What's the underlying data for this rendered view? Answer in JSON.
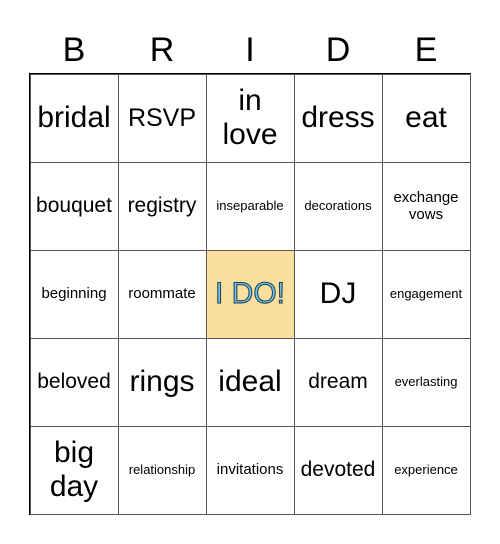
{
  "header": [
    "B",
    "R",
    "I",
    "D",
    "E"
  ],
  "cells": [
    {
      "text": "bridal",
      "size": "l"
    },
    {
      "text": "RSVP",
      "size": "m2"
    },
    {
      "text": "in love",
      "size": "l"
    },
    {
      "text": "dress",
      "size": "l"
    },
    {
      "text": "eat",
      "size": "l"
    },
    {
      "text": "bouquet",
      "size": "m"
    },
    {
      "text": "registry",
      "size": "m"
    },
    {
      "text": "inseparable",
      "size": "xs"
    },
    {
      "text": "decorations",
      "size": "xs"
    },
    {
      "text": "exchange vows",
      "size": "s"
    },
    {
      "text": "beginning",
      "size": "s"
    },
    {
      "text": "roommate",
      "size": "s"
    },
    {
      "text": "I DO!",
      "size": "free"
    },
    {
      "text": "DJ",
      "size": "l"
    },
    {
      "text": "engagement",
      "size": "xs"
    },
    {
      "text": "beloved",
      "size": "m"
    },
    {
      "text": "rings",
      "size": "l"
    },
    {
      "text": "ideal",
      "size": "l"
    },
    {
      "text": "dream",
      "size": "m"
    },
    {
      "text": "everlasting",
      "size": "xs"
    },
    {
      "text": "big day",
      "size": "l"
    },
    {
      "text": "relationship",
      "size": "xs"
    },
    {
      "text": "invitations",
      "size": "s"
    },
    {
      "text": "devoted",
      "size": "m"
    },
    {
      "text": "experience",
      "size": "xs"
    }
  ],
  "colors": {
    "free_bg": "#fbdf9f",
    "free_text": "#6ec3e8"
  }
}
